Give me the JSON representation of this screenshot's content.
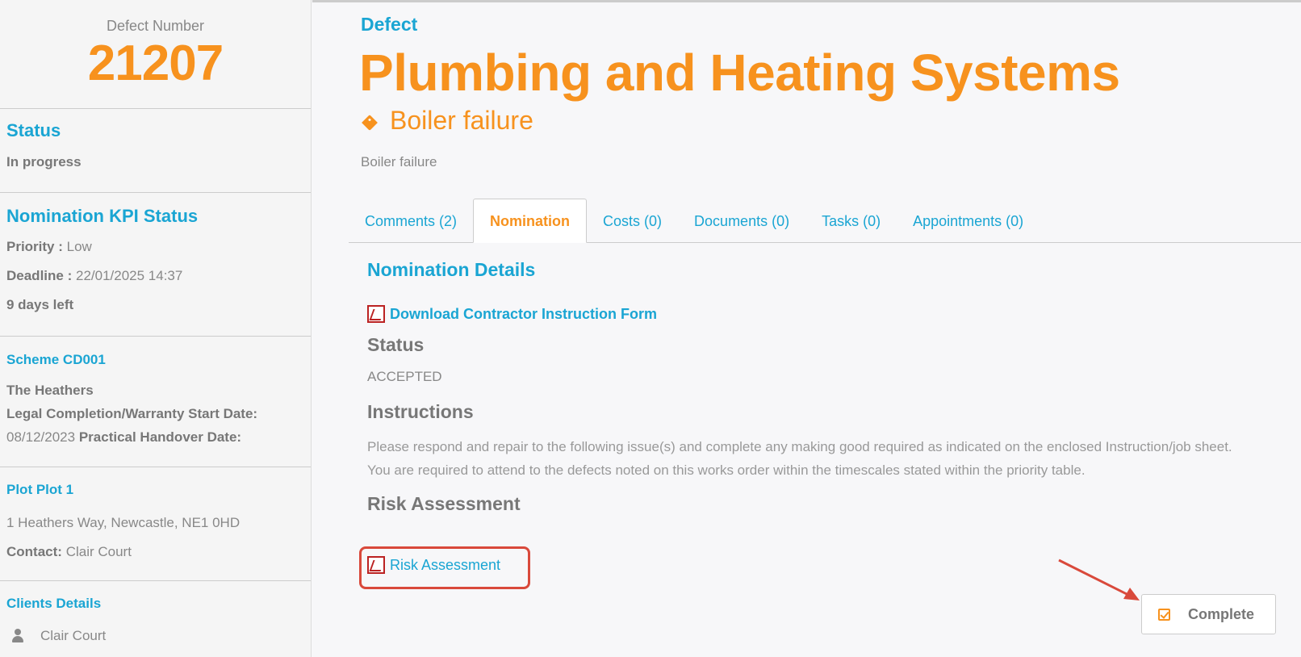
{
  "sidebar": {
    "defect_number_label": "Defect Number",
    "defect_number": "21207",
    "status_heading": "Status",
    "status_value": "In progress",
    "kpi_heading": "Nomination KPI Status",
    "priority_label": "Priority :",
    "priority_value": "Low",
    "deadline_label": "Deadline :",
    "deadline_value": "22/01/2025 14:37",
    "days_left": "9 days left",
    "scheme_heading": "Scheme CD001",
    "scheme_name": "The Heathers",
    "legal_label": "Legal Completion/Warranty Start Date:",
    "legal_value": "08/12/2023",
    "handover_label": "Practical Handover Date:",
    "plot_heading": "Plot Plot 1",
    "plot_address": "1 Heathers Way, Newcastle, NE1 0HD",
    "contact_label": "Contact:",
    "contact_value": "Clair Court",
    "clients_heading": "Clients Details",
    "client_name": "Clair Court"
  },
  "header": {
    "defect_label": "Defect",
    "title": "Plumbing and Heating Systems",
    "subtitle": "Boiler failure",
    "description": "Boiler failure"
  },
  "tabs": [
    {
      "label": "Comments (2)"
    },
    {
      "label": "Nomination",
      "active": true
    },
    {
      "label": "Costs (0)"
    },
    {
      "label": "Documents (0)"
    },
    {
      "label": "Tasks (0)"
    },
    {
      "label": "Appointments (0)"
    }
  ],
  "nomination": {
    "title": "Nomination Details",
    "download_link": "Download Contractor Instruction Form",
    "status_heading": "Status",
    "status_value": "ACCEPTED",
    "instructions_heading": "Instructions",
    "instructions_text": "Please respond and repair to the following issue(s) and complete any making good required as indicated on the enclosed Instruction/job sheet. You are required to attend to the defects noted on this works order within the timescales stated within the priority table.",
    "risk_heading": "Risk Assessment",
    "risk_link": "Risk Assessment"
  },
  "actions": {
    "complete_label": "Complete"
  },
  "colors": {
    "accent_blue": "#1aa5d3",
    "accent_orange": "#f7921e",
    "highlight_red": "#d9493b"
  },
  "icons": [
    "tag-icon",
    "pdf-icon",
    "person-icon",
    "check-icon",
    "annotation-arrow"
  ]
}
